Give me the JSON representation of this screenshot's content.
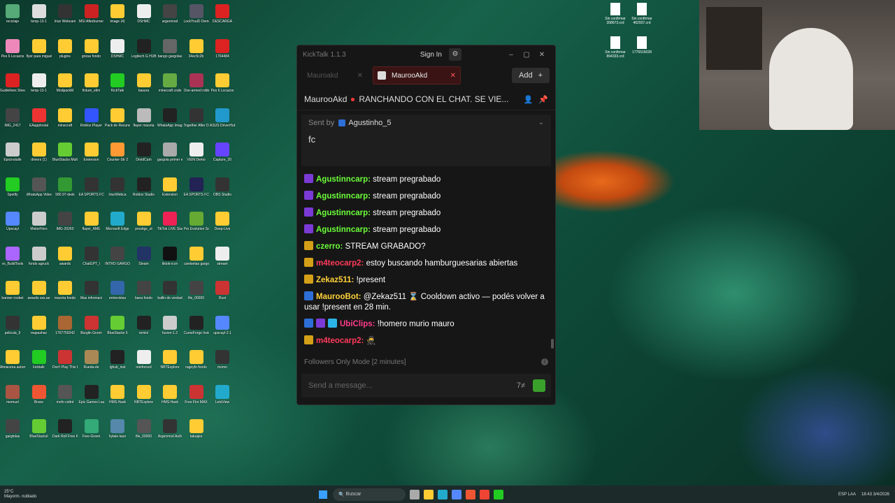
{
  "desktop": {
    "icons": [
      {
        "label": "reciclaje",
        "color": "#5a7"
      },
      {
        "label": "temp-13-1",
        "color": "#ddd"
      },
      {
        "label": "Iriun Webcam",
        "color": "#333"
      },
      {
        "label": "MSI Afterburner",
        "color": "#c22"
      },
      {
        "label": "image (4)",
        "color": "#fc3"
      },
      {
        "label": "DSHMC",
        "color": "#eee"
      },
      {
        "label": "argenmod",
        "color": "#444"
      },
      {
        "label": "LockYouID Demo",
        "color": "#556"
      },
      {
        "label": "DESCARGA",
        "color": "#d22"
      },
      {
        "label": "Pes 6 Locazos",
        "color": "#e8b"
      },
      {
        "label": "flyer para miguel",
        "color": "#fc3"
      },
      {
        "label": "plugins",
        "color": "#fc3"
      },
      {
        "label": "grizas fondo",
        "color": "#fc3"
      },
      {
        "label": "DSHMC",
        "color": "#eee"
      },
      {
        "label": "Logitech G HUB",
        "color": "#222"
      },
      {
        "label": "bango gargolas",
        "color": "#666"
      },
      {
        "label": "34ec5c2b",
        "color": "#fc3"
      },
      {
        "label": "1764484",
        "color": "#d22"
      },
      {
        "label": "Guidelines Streams",
        "color": "#d22"
      },
      {
        "label": "temp-13-1",
        "color": "#eee"
      },
      {
        "label": "ModpackM",
        "color": "#fc3"
      },
      {
        "label": "fixture_elim",
        "color": "#fc3"
      },
      {
        "label": "KickTalk",
        "color": "#2c2"
      },
      {
        "label": "basura",
        "color": "#fc3"
      },
      {
        "label": "minecraft code",
        "color": "#6a4"
      },
      {
        "label": "One-armed robber",
        "color": "#a35"
      },
      {
        "label": "Pes 6 Locazos",
        "color": "#fc3"
      },
      {
        "label": "IMG_2417",
        "color": "#444"
      },
      {
        "label": "EAappInstal",
        "color": "#e33"
      },
      {
        "label": "minecraft",
        "color": "#fc3"
      },
      {
        "label": "Roblox Player",
        "color": "#35f"
      },
      {
        "label": "Pack de Recursos",
        "color": "#fc3"
      },
      {
        "label": "flayer maceta",
        "color": "#bbb"
      },
      {
        "label": "WhatsApp Image 2026",
        "color": "#222"
      },
      {
        "label": "Together After Dark",
        "color": "#333"
      },
      {
        "label": "ASUS DriverHub",
        "color": "#29c"
      },
      {
        "label": "Epicinstalle",
        "color": "#ccc"
      },
      {
        "label": "drivers (1)",
        "color": "#fc3"
      },
      {
        "label": "BlueStacks Multi-Insta",
        "color": "#6c3"
      },
      {
        "label": "Extension",
        "color": "#fc3"
      },
      {
        "label": "Counter-Str 2",
        "color": "#f93"
      },
      {
        "label": "DroidCam",
        "color": "#222"
      },
      {
        "label": "gargola primer e",
        "color": "#aaa"
      },
      {
        "label": "VEIN Demo",
        "color": "#eee"
      },
      {
        "label": "Capture_20",
        "color": "#64f"
      },
      {
        "label": "Spotify",
        "color": "#2c2"
      },
      {
        "label": "WhatsApp Video 2025",
        "color": "#555"
      },
      {
        "label": "580.97-desk",
        "color": "#393"
      },
      {
        "label": "EA SPORTS FC 26",
        "color": "#333"
      },
      {
        "label": "IriunWebca",
        "color": "#333"
      },
      {
        "label": "Roblox Studio",
        "color": "#222"
      },
      {
        "label": "Extension",
        "color": "#fc3"
      },
      {
        "label": "EA SPORTS FC 26",
        "color": "#225"
      },
      {
        "label": "OBS Studio",
        "color": "#333"
      },
      {
        "label": "Upscayl",
        "color": "#58f"
      },
      {
        "label": "MisterHors",
        "color": "#ccc"
      },
      {
        "label": "IMG-20260",
        "color": "#444"
      },
      {
        "label": "flayer_AME",
        "color": "#fc3"
      },
      {
        "label": "Microsoft Edge",
        "color": "#2ac"
      },
      {
        "label": "prestige_st",
        "color": "#fc3"
      },
      {
        "label": "TikTok LIVE Studio",
        "color": "#e25"
      },
      {
        "label": "Pro Evolution Soccer 6",
        "color": "#6a3"
      },
      {
        "label": "Deep-Live",
        "color": "#fc3"
      },
      {
        "label": "vs_BuildTools",
        "color": "#a6f"
      },
      {
        "label": "fondo agruck",
        "color": "#ccc"
      },
      {
        "label": "awards",
        "color": "#fc3"
      },
      {
        "label": "ChatGPT_l",
        "color": "#333"
      },
      {
        "label": "INTRO GARGO",
        "color": "#444"
      },
      {
        "label": "Steam",
        "color": "#236"
      },
      {
        "label": "tiktok-icon",
        "color": "#111"
      },
      {
        "label": "camisetas gargolas",
        "color": "#fc3"
      },
      {
        "label": "stream",
        "color": "#eee"
      },
      {
        "label": "banner roobet",
        "color": "#fc3"
      },
      {
        "label": "awards sss.ae",
        "color": "#fc3"
      },
      {
        "label": "maceta fondo",
        "color": "#fc3"
      },
      {
        "label": "Mas informaci",
        "color": "#333"
      },
      {
        "label": "entrevistas",
        "color": "#36a"
      },
      {
        "label": "bana fondo",
        "color": "#444"
      },
      {
        "label": "ballin de verdad",
        "color": "#333"
      },
      {
        "label": "file_00000",
        "color": "#444"
      },
      {
        "label": "Rust",
        "color": "#c33"
      },
      {
        "label": "pelicula_9",
        "color": "#333"
      },
      {
        "label": "mapashax",
        "color": "#fc3"
      },
      {
        "label": "1767759342",
        "color": "#a63"
      },
      {
        "label": "Burglin Gnom",
        "color": "#c33"
      },
      {
        "label": "BlueStacks 5",
        "color": "#6c3"
      },
      {
        "label": "remini",
        "color": "#222"
      },
      {
        "label": "fusion-1.2",
        "color": "#ccc"
      },
      {
        "label": "CurseForge Installer",
        "color": "#222"
      },
      {
        "label": "upscayl-2.1",
        "color": "#58f"
      },
      {
        "label": "Almacena automatic",
        "color": "#fc3"
      },
      {
        "label": "kicktalk",
        "color": "#2c2"
      },
      {
        "label": "Don't Play This Demo",
        "color": "#c33"
      },
      {
        "label": "Rueda-de",
        "color": "#a85"
      },
      {
        "label": "lghub_inst",
        "color": "#222"
      },
      {
        "label": "reinforced",
        "color": "#eee"
      },
      {
        "label": "NBTExplore",
        "color": "#fc3"
      },
      {
        "label": "rageyfo fondo",
        "color": "#fc3"
      },
      {
        "label": "momo",
        "color": "#333"
      },
      {
        "label": "memuel",
        "color": "#a54"
      },
      {
        "label": "Brave",
        "color": "#e53"
      },
      {
        "label": "mofo cottnt",
        "color": "#555"
      },
      {
        "label": "Epic Games Launcher",
        "color": "#222"
      },
      {
        "label": "HMS.Hask",
        "color": "#fc3"
      },
      {
        "label": "NBTExplore",
        "color": "#fc3"
      },
      {
        "label": "HMS.Hask",
        "color": "#fc3"
      },
      {
        "label": "Free Fire MAX",
        "color": "#c33"
      },
      {
        "label": "LetsView",
        "color": "#2ac"
      },
      {
        "label": "gargtolas",
        "color": "#444"
      },
      {
        "label": "BlueStacksI",
        "color": "#6c3"
      },
      {
        "label": "Dark Roll Free Kic",
        "color": "#222"
      },
      {
        "label": "Free-Green",
        "color": "#3a7"
      },
      {
        "label": "hytale-laun",
        "color": "#58a"
      },
      {
        "label": "file_00000",
        "color": "#555"
      },
      {
        "label": "Argenmod Auth",
        "color": "#333"
      },
      {
        "label": "tatuajes",
        "color": "#fc3"
      }
    ],
    "top_files": [
      {
        "label": "Sin confirmar 358673.crd"
      },
      {
        "label": "Sin confirmar 462937.crd"
      },
      {
        "label": "Sin confirmar 894333.crd"
      },
      {
        "label": "1776516028"
      }
    ]
  },
  "window": {
    "app_title": "KickTalk 1.1.3",
    "sign_in": "Sign In",
    "tabs": [
      {
        "label": "Mauroakd",
        "active": false
      },
      {
        "label": "MaurooAkd",
        "active": true
      }
    ],
    "add_label": "Add",
    "channel": "MaurooAkd",
    "stream_title": "RANCHANDO CON EL CHAT. SE VIE...",
    "pinned": {
      "sent_by": "Sent by",
      "user": "Agustinho_5",
      "message": "fc"
    },
    "messages": [
      {
        "badges": [
          "b-sub"
        ],
        "user": "Agustinncarp:",
        "user_class": "u-green",
        "text": "stream pregrabado"
      },
      {
        "badges": [
          "b-sub"
        ],
        "user": "Agustinncarp:",
        "user_class": "u-green",
        "text": "stream pregrabado"
      },
      {
        "badges": [
          "b-sub"
        ],
        "user": "Agustinncarp:",
        "user_class": "u-green",
        "text": "stream pregrabado"
      },
      {
        "badges": [
          "b-sub"
        ],
        "user": "Agustinncarp:",
        "user_class": "u-green",
        "text": "stream pregrabado"
      },
      {
        "badges": [
          "b-crown"
        ],
        "user": "czerro:",
        "user_class": "u-green",
        "text": "STREAM GRABADO?"
      },
      {
        "badges": [
          "b-crown"
        ],
        "user": "m4teocarp2:",
        "user_class": "u-red",
        "text": "estoy buscando hamburguesarias abiertas"
      },
      {
        "badges": [
          "b-crown"
        ],
        "user": "Zekaz511:",
        "user_class": "u-yellow",
        "text": "!present"
      },
      {
        "badges": [
          "b-bot"
        ],
        "user": "MaurooBot:",
        "user_class": "u-yellow",
        "text": "@Zekaz511 ⌛ Cooldown activo — podés volver a usar !present en 28 min."
      },
      {
        "badges": [
          "b-bot",
          "b-sub",
          "b-cube"
        ],
        "user": "UbiClips:",
        "user_class": "u-pink",
        "text": "!homero murio mauro"
      },
      {
        "badges": [
          "b-crown"
        ],
        "user": "m4teocarp2:",
        "user_class": "u-red",
        "text": "🥷"
      }
    ],
    "footer_mode": "Followers Only Mode [2 minutes]",
    "input_placeholder": "Send a message..."
  },
  "taskbar": {
    "weather_temp": "25°C",
    "weather_text": "Mayorm. nublado",
    "search": "Buscar",
    "lang": "ESP LAA",
    "time": "18:43",
    "date": "3/4/2026"
  }
}
